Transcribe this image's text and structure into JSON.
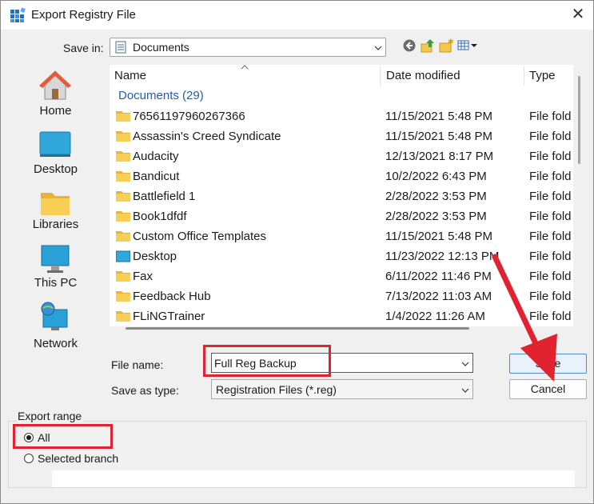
{
  "window": {
    "title": "Export Registry File",
    "close_glyph": "✕"
  },
  "save_in": {
    "label": "Save in:",
    "value": "Documents"
  },
  "places": [
    {
      "label": "Home",
      "icon": "home-icon"
    },
    {
      "label": "Desktop",
      "icon": "desktop-icon"
    },
    {
      "label": "Libraries",
      "icon": "libraries-icon"
    },
    {
      "label": "This PC",
      "icon": "this-pc-icon"
    },
    {
      "label": "Network",
      "icon": "network-icon"
    }
  ],
  "file_list": {
    "columns": [
      "Name",
      "Date modified",
      "Type"
    ],
    "group_label": "Documents (29)",
    "rows": [
      {
        "name": "76561197960267366",
        "date": "11/15/2021 5:48 PM",
        "type": "File fold",
        "icon": "folder-icon"
      },
      {
        "name": "Assassin's Creed Syndicate",
        "date": "11/15/2021 5:48 PM",
        "type": "File fold",
        "icon": "folder-icon"
      },
      {
        "name": "Audacity",
        "date": "12/13/2021 8:17 PM",
        "type": "File fold",
        "icon": "folder-icon"
      },
      {
        "name": "Bandicut",
        "date": "10/2/2022 6:43 PM",
        "type": "File fold",
        "icon": "folder-icon"
      },
      {
        "name": "Battlefield 1",
        "date": "2/28/2022 3:53 PM",
        "type": "File fold",
        "icon": "folder-icon"
      },
      {
        "name": "Book1dfdf",
        "date": "2/28/2022 3:53 PM",
        "type": "File fold",
        "icon": "folder-icon"
      },
      {
        "name": "Custom Office Templates",
        "date": "11/15/2021 5:48 PM",
        "type": "File fold",
        "icon": "folder-icon"
      },
      {
        "name": "Desktop",
        "date": "11/23/2022 12:13 PM",
        "type": "File fold",
        "icon": "desktop-folder-icon"
      },
      {
        "name": "Fax",
        "date": "6/11/2022 11:46 PM",
        "type": "File fold",
        "icon": "folder-icon"
      },
      {
        "name": "Feedback Hub",
        "date": "7/13/2022 11:03 AM",
        "type": "File fold",
        "icon": "folder-icon"
      },
      {
        "name": "FLiNGTrainer",
        "date": "1/4/2022 11:26 AM",
        "type": "File fold",
        "icon": "folder-icon"
      }
    ]
  },
  "file_name": {
    "label": "File name:",
    "value": "Full Reg Backup"
  },
  "save_as_type": {
    "label": "Save as type:",
    "value": "Registration Files (*.reg)"
  },
  "buttons": {
    "save": "Save",
    "cancel": "Cancel"
  },
  "export_range": {
    "label": "Export range",
    "options": [
      {
        "label": "All",
        "selected": true
      },
      {
        "label": "Selected branch",
        "selected": false
      }
    ],
    "branch_value": ""
  },
  "colors": {
    "highlight": "#e0232f",
    "group_text": "#1f5fb0"
  }
}
